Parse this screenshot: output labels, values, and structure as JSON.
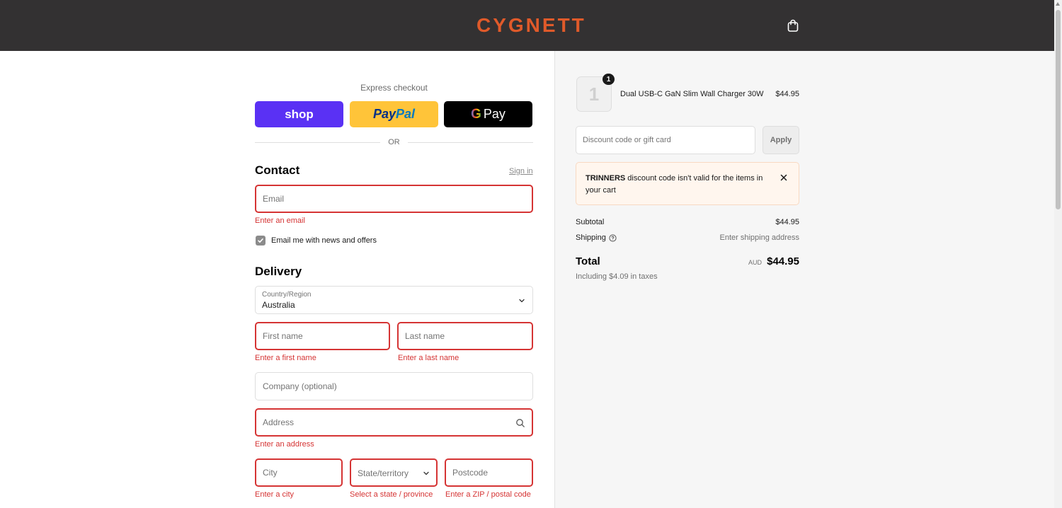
{
  "header": {
    "brand": "CYGNETT",
    "cart_icon": "shopping-bag-icon"
  },
  "express": {
    "label": "Express checkout",
    "shop_label": "shop",
    "paypal_part1": "Pay",
    "paypal_part2": "Pal",
    "gpay_g": "G",
    "gpay_label": "Pay",
    "or_text": "OR"
  },
  "contact": {
    "title": "Contact",
    "sign_in": "Sign in",
    "email_placeholder": "Email",
    "email_error": "Enter an email",
    "newsletter_label": "Email me with news and offers",
    "newsletter_checked": true
  },
  "delivery": {
    "title": "Delivery",
    "country_label": "Country/Region",
    "country_value": "Australia",
    "first_name_placeholder": "First name",
    "first_name_error": "Enter a first name",
    "last_name_placeholder": "Last name",
    "last_name_error": "Enter a last name",
    "company_placeholder": "Company (optional)",
    "address_placeholder": "Address",
    "address_error": "Enter an address",
    "city_placeholder": "City",
    "city_error": "Enter a city",
    "state_placeholder": "State/territory",
    "state_error": "Select a state / province",
    "postcode_placeholder": "Postcode",
    "postcode_error": "Enter a ZIP / postal code"
  },
  "order": {
    "item": {
      "name": "Dual USB-C GaN Slim Wall Charger 30W",
      "price": "$44.95",
      "quantity": "1",
      "thumb_glyph": "1"
    },
    "discount_placeholder": "Discount code or gift card",
    "apply_label": "Apply",
    "notice_code": "TRINNERS",
    "notice_message": " discount code isn't valid for the items in your cart",
    "subtotal_label": "Subtotal",
    "subtotal_value": "$44.95",
    "shipping_label": "Shipping",
    "shipping_value": "Enter shipping address",
    "total_label": "Total",
    "total_currency": "AUD",
    "total_value": "$44.95",
    "tax_note": "Including $4.09 in taxes"
  },
  "colors": {
    "header_bg": "#333132",
    "brand": "#e05a2a",
    "error": "#d53434",
    "shop_pay": "#5a31f4",
    "paypal": "#ffc439"
  }
}
